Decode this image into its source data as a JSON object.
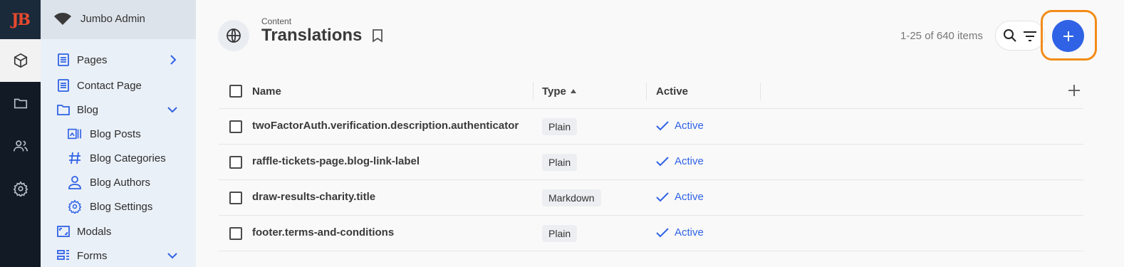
{
  "rail": {
    "logo_text": "JB",
    "items": [
      {
        "icon": "cube-icon",
        "active": true
      },
      {
        "icon": "folder-icon",
        "active": false
      },
      {
        "icon": "users-icon",
        "active": false
      },
      {
        "icon": "gear-icon",
        "active": false
      }
    ]
  },
  "sidebar": {
    "site_name": "Jumbo Admin",
    "items": [
      {
        "label": "Pages",
        "icon": "page-icon",
        "chevron": "right"
      },
      {
        "label": "Contact Page",
        "icon": "page-icon"
      },
      {
        "label": "Blog",
        "icon": "folder-icon",
        "chevron": "down"
      },
      {
        "label": "Blog Posts",
        "icon": "blog-posts-icon",
        "child": true
      },
      {
        "label": "Blog Categories",
        "icon": "hash-icon",
        "child": true
      },
      {
        "label": "Blog Authors",
        "icon": "person-icon",
        "child": true
      },
      {
        "label": "Blog Settings",
        "icon": "gear-icon",
        "child": true
      },
      {
        "label": "Modals",
        "icon": "modal-icon"
      },
      {
        "label": "Forms",
        "icon": "forms-icon",
        "chevron": "down"
      }
    ]
  },
  "header": {
    "breadcrumb": "Content",
    "title": "Translations",
    "count": "1-25 of 640 items"
  },
  "table": {
    "columns": [
      "Name",
      "Type",
      "Active"
    ],
    "rows": [
      {
        "name": "twoFactorAuth.verification.description.authenticator",
        "type": "Plain",
        "active": "Active"
      },
      {
        "name": "raffle-tickets-page.blog-link-label",
        "type": "Plain",
        "active": "Active"
      },
      {
        "name": "draw-results-charity.title",
        "type": "Markdown",
        "active": "Active"
      },
      {
        "name": "footer.terms-and-conditions",
        "type": "Plain",
        "active": "Active"
      }
    ]
  },
  "colors": {
    "accent": "#2f62e5",
    "highlight": "#f28c18",
    "rail_bg": "#111a25",
    "sidebar_bg": "#eaf0f7"
  }
}
